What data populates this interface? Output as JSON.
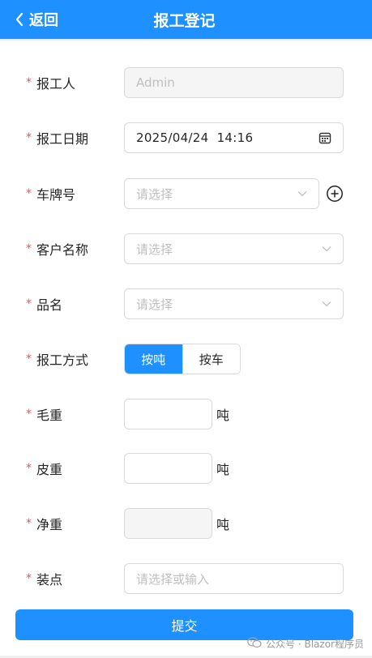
{
  "header": {
    "back_label": "返回",
    "title": "报工登记",
    "background": "#1e90ff"
  },
  "required_mark": "*",
  "form": {
    "reporter": {
      "label": "报工人",
      "value": "Admin"
    },
    "report_date": {
      "label": "报工日期",
      "value": "2025/04/24  14:16",
      "icon": "calendar-icon"
    },
    "plate_number": {
      "label": "车牌号",
      "placeholder": "请选择",
      "icon": "chevron-down-icon",
      "add_icon": "plus-circle-icon"
    },
    "customer_name": {
      "label": "客户名称",
      "placeholder": "请选择",
      "icon": "chevron-down-icon"
    },
    "product_name": {
      "label": "品名",
      "placeholder": "请选择",
      "icon": "chevron-down-icon"
    },
    "report_method": {
      "label": "报工方式",
      "options": [
        "按吨",
        "按车"
      ],
      "selected": "按吨"
    },
    "gross_weight": {
      "label": "毛重",
      "value": "",
      "unit": "吨"
    },
    "tare_weight": {
      "label": "皮重",
      "value": "",
      "unit": "吨"
    },
    "net_weight": {
      "label": "净重",
      "value": "",
      "unit": "吨"
    },
    "loading_point": {
      "label": "装点",
      "placeholder": "请选择或输入"
    }
  },
  "submit_label": "提交",
  "watermark": {
    "text": "公众号 · Blazor程序员"
  },
  "colors": {
    "accent": "#1e90ff",
    "required": "#ff4d4f",
    "border": "#d9d9d9",
    "placeholder": "#bfbfbf",
    "disabled_bg": "#f5f5f5"
  }
}
